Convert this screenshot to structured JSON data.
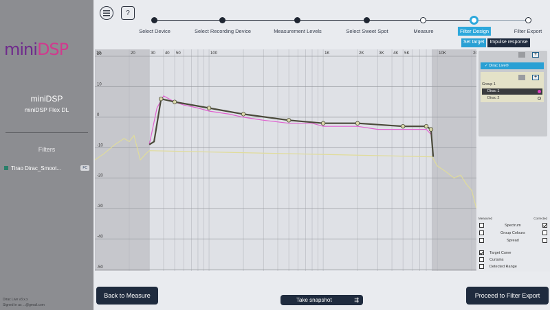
{
  "sidebar": {
    "logo_text": "miniDSP",
    "device_title": "miniDSP",
    "device_model": "miniDSP Flex DL",
    "filters_label": "Filters",
    "filter_item": "Tirao Dirac_Smoot...",
    "filter_badge": "FC",
    "version_text": "Dirac Live v3.x.x",
    "signed_text": "Signed in as ...@gmail.com"
  },
  "top": {
    "menu_icon": "hamburger-icon",
    "help_label": "?"
  },
  "steps": [
    {
      "label": "Select Device",
      "state": "done"
    },
    {
      "label": "Select Recording Device",
      "state": "done"
    },
    {
      "label": "Measurement Levels",
      "state": "done"
    },
    {
      "label": "Select Sweet Spot",
      "state": "done"
    },
    {
      "label": "Measure",
      "state": "todo"
    },
    {
      "label": "Filter Design",
      "state": "current"
    },
    {
      "label": "Filter Export",
      "state": "todo"
    }
  ],
  "subtabs": {
    "set_target": "Set target",
    "impulse_response": "Impulse response"
  },
  "chart": {
    "x_ticks": [
      "10",
      "20",
      "30",
      "40",
      "50",
      "100",
      "1K",
      "2K",
      "3K",
      "4K",
      "5K",
      "10K",
      "20K"
    ],
    "y_ticks": [
      "20",
      "10",
      "0",
      "-10",
      "-20",
      "-30",
      "-40",
      "-50"
    ]
  },
  "chart_data": {
    "type": "line",
    "xscale": "log",
    "xlim": [
      10,
      22000
    ],
    "ylim": [
      -50,
      20
    ],
    "series": [
      {
        "color": "#e060d0",
        "x": [
          30,
          35,
          40,
          50,
          60,
          80,
          100,
          150,
          200,
          300,
          500,
          800,
          1000,
          2000,
          3000,
          5000,
          8000,
          9000
        ],
        "y": [
          -9,
          3,
          7,
          5,
          4,
          3,
          2,
          1,
          0,
          -1,
          -2,
          -2,
          -3,
          -3,
          -4,
          -4,
          -4,
          -6
        ]
      },
      {
        "color": "#4a4a3a",
        "x": [
          30,
          33,
          38,
          50,
          100,
          200,
          500,
          1000,
          2000,
          5000,
          8000,
          8800,
          9200
        ],
        "y": [
          -9,
          -8,
          6,
          5,
          3,
          1,
          -1,
          -2,
          -2,
          -3,
          -3,
          -4,
          -13
        ]
      },
      {
        "color": "#e0dc9a",
        "x": [
          10,
          12,
          15,
          18,
          20,
          22,
          25,
          28,
          30,
          9000,
          10000,
          12000,
          14000,
          16000,
          18000,
          20000,
          22000
        ],
        "y": [
          -14,
          -12,
          -9,
          -7,
          -8,
          -6,
          -14,
          -12,
          -11,
          -13,
          -16,
          -18,
          -20,
          -19,
          -22,
          -24,
          -30
        ]
      }
    ]
  },
  "right_panel": {
    "dirac_live_label": "Dirac Live®",
    "group_label": "Group 1",
    "dirac1_label": "Dirac 1",
    "dirac2_label": "Dirac 2",
    "measured_label": "Measured",
    "corrected_label": "Corrected",
    "spectrum_label": "Spectrum",
    "group_colours_label": "Group Colours",
    "spread_label": "Spread",
    "target_curve_label": "Target Curve",
    "curtains_label": "Curtains",
    "detected_range_label": "Detected Range",
    "dirac1_color": "#e040c0"
  },
  "bottom": {
    "back_label": "Back to Measure",
    "snapshot_label": "Take snapshot",
    "proceed_label": "Proceed to Filter Export"
  }
}
